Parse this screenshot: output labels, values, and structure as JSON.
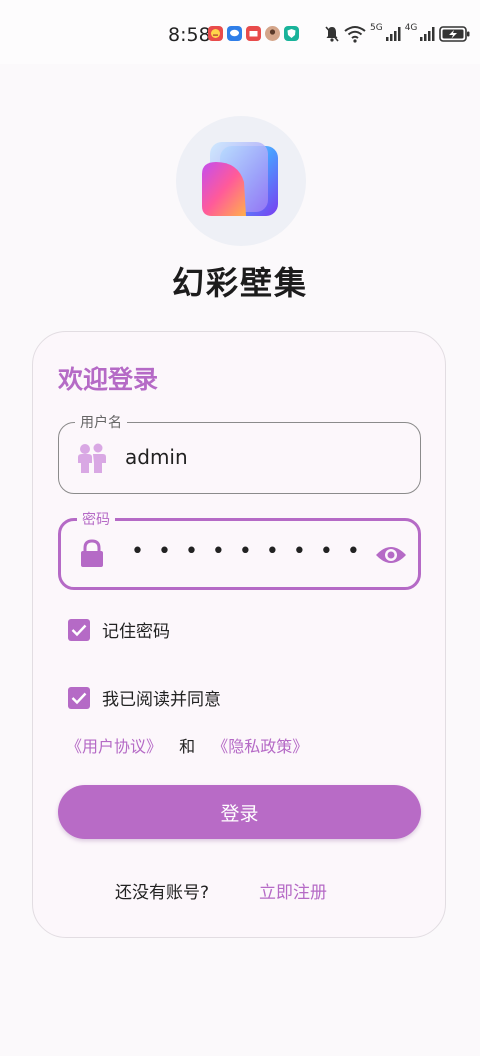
{
  "status_bar": {
    "time": "8:58",
    "notification_icons": [
      "angry-face-app-icon",
      "chat-app-icon",
      "mail-app-icon",
      "avatar-app-icon",
      "shield-app-icon"
    ],
    "system_icons": [
      "bell-muted-icon",
      "wifi-icon",
      "signal-5g-icon",
      "signal-4g-icon",
      "battery-charging-icon"
    ],
    "network_5g": "5G",
    "network_4g": "4G"
  },
  "app": {
    "logo_icon": "stacked-gradient-cards-logo",
    "title": "幻彩壁集"
  },
  "login_card": {
    "heading": "欢迎登录",
    "username": {
      "label": "用户名",
      "value": "admin",
      "icon": "user-icon"
    },
    "password": {
      "label": "密码",
      "value_masked": "•••••••••",
      "icon": "lock-icon",
      "toggle_icon": "eye-icon"
    },
    "remember_password": {
      "label": "记住密码",
      "checked": true
    },
    "agreement": {
      "label": "我已阅读并同意",
      "checked": true,
      "user_agreement": "《用户协议》",
      "and": "和",
      "privacy_policy": "《隐私政策》"
    },
    "login_button": "登录",
    "no_account": "还没有账号?",
    "register_link": "立即注册"
  },
  "colors": {
    "accent": "#b56ac6",
    "background": "#fbf9fb",
    "card": "#fcf7fb"
  }
}
